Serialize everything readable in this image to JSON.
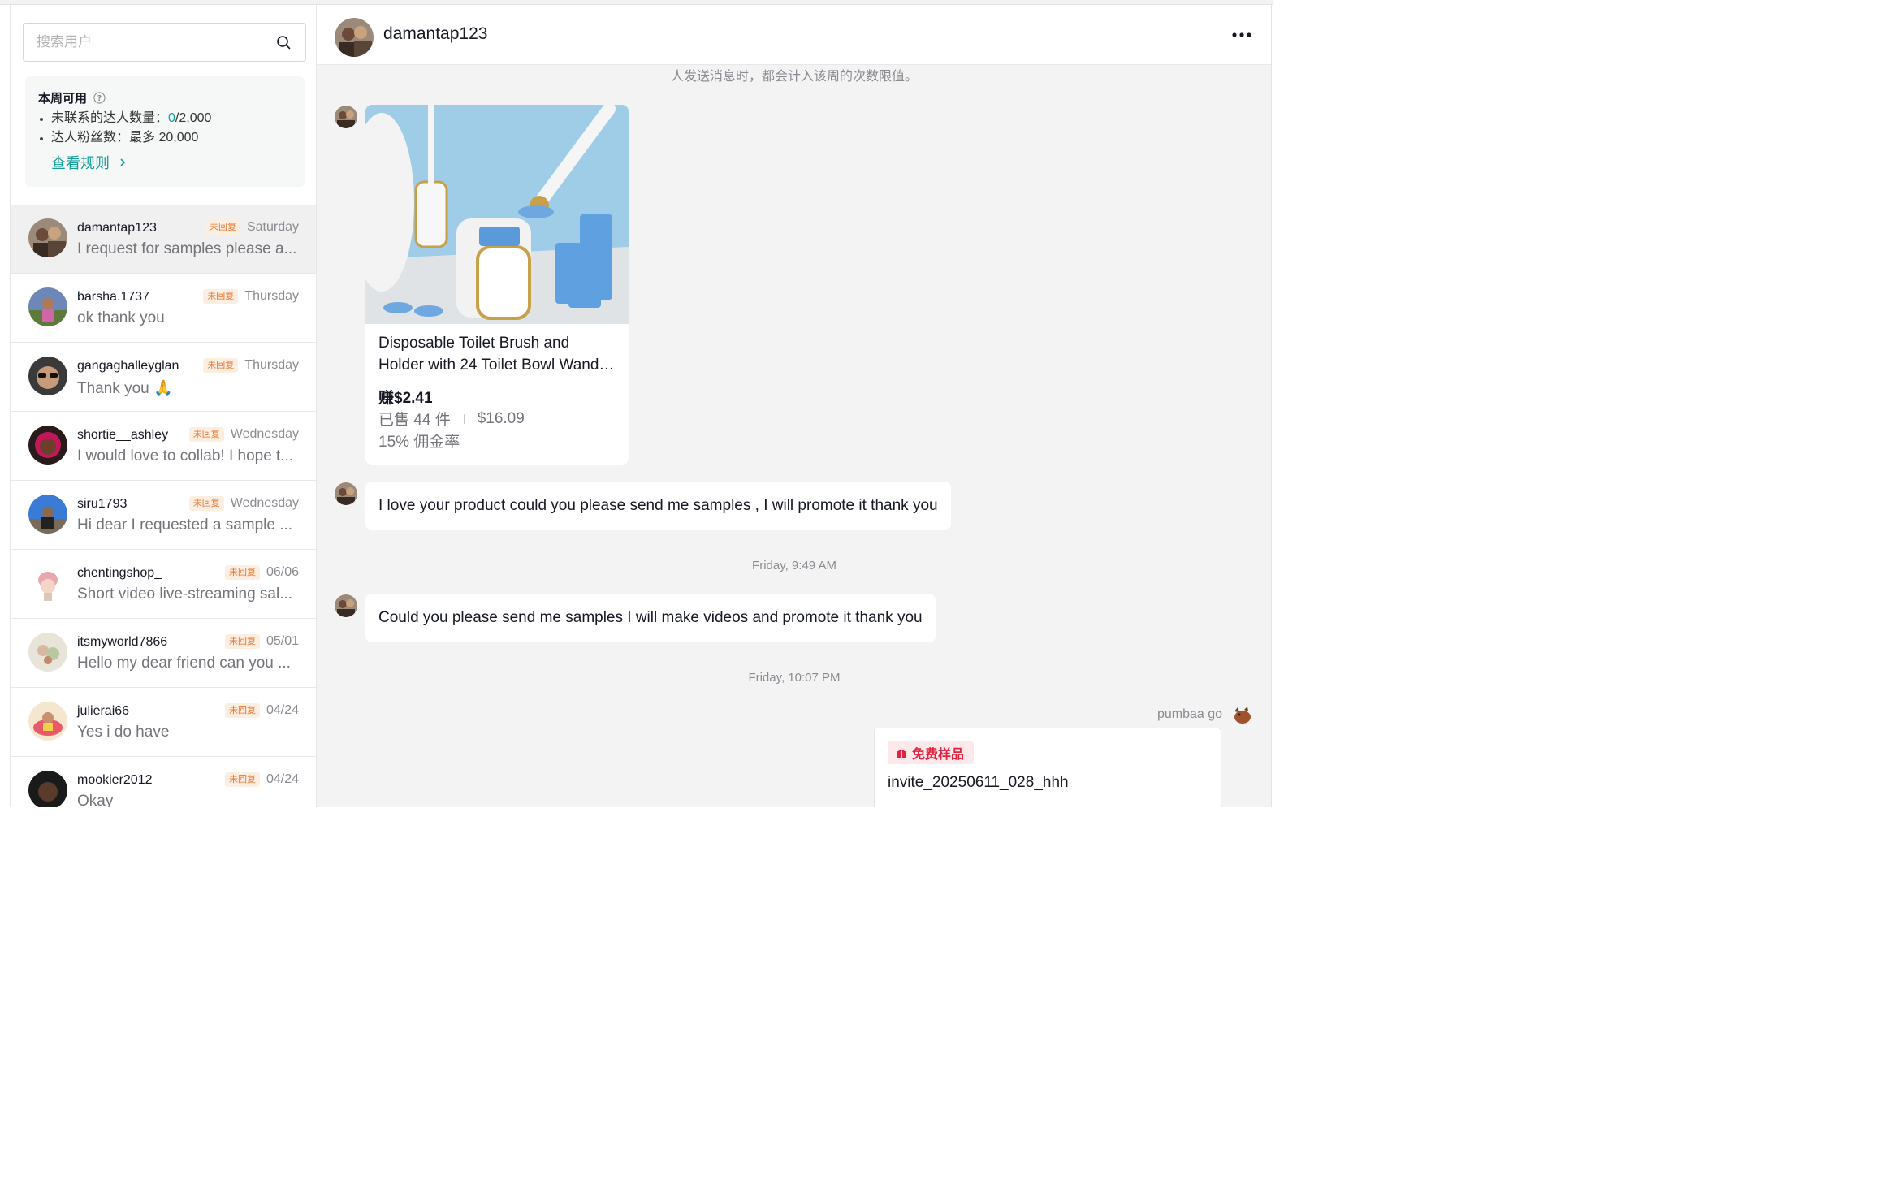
{
  "search": {
    "placeholder": "搜索用户"
  },
  "quota": {
    "title": "本周可用",
    "item1_label": "未联系的达人数量：",
    "item1_used": "0",
    "item1_total": "/2,000",
    "item2": "达人粉丝数：最多 20,000",
    "rules_link": "查看规则"
  },
  "conversations": [
    {
      "name": "damantap123",
      "badge": "未回复",
      "time": "Saturday",
      "message": "I request for samples please a..."
    },
    {
      "name": "barsha.1737",
      "badge": "未回复",
      "time": "Thursday",
      "message": "ok thank you"
    },
    {
      "name": "gangaghalleyglan",
      "badge": "未回复",
      "time": "Thursday",
      "message": "Thank you 🙏"
    },
    {
      "name": "shortie__ashley",
      "badge": "未回复",
      "time": "Wednesday",
      "message": "I would love to collab! I hope t..."
    },
    {
      "name": "siru1793",
      "badge": "未回复",
      "time": "Wednesday",
      "message": "Hi dear I requested a sample ..."
    },
    {
      "name": "chentingshop_",
      "badge": "未回复",
      "time": "06/06",
      "message": "Short video live-streaming sal..."
    },
    {
      "name": "itsmyworld7866",
      "badge": "未回复",
      "time": "05/01",
      "message": "Hello my dear friend can you ..."
    },
    {
      "name": "julierai66",
      "badge": "未回复",
      "time": "04/24",
      "message": "Yes i do have"
    },
    {
      "name": "mookier2012",
      "badge": "未回复",
      "time": "04/24",
      "message": "Okay"
    }
  ],
  "chat": {
    "title": "damantap123",
    "system_note": "人发送消息时，都会计入该周的次数限值。",
    "product": {
      "title": "Disposable Toilet Brush and Holder with 24 Toilet Bowl Wand Ref...",
      "earn": "赚$2.41",
      "sold": "已售 44 件",
      "price": "$16.09",
      "commission": "15% 佣金率"
    },
    "message1": "I love your product could you please send me samples , I will promote it thank you",
    "timestamp1": "Friday, 9:49 AM",
    "message2": "Could you please send me samples I will make videos  and promote it thank you",
    "timestamp2": "Friday, 10:07 PM",
    "sender": "pumbaa go",
    "sample": {
      "tag": "免费样品",
      "code": "invite_20250611_028_hhh"
    }
  },
  "colors": {
    "accent": "#14a09a",
    "badge_text": "#e8762c",
    "sample_tag": "#e0233f"
  }
}
